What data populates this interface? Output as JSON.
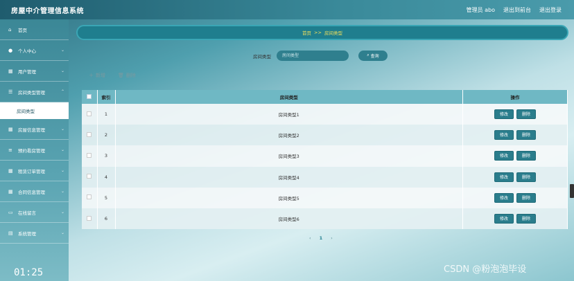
{
  "header": {
    "app_title": "房屋中介管理信息系统",
    "user_label": "管理员 abo",
    "console_label": "退出到前台",
    "logout_label": "退出登录"
  },
  "sidebar": {
    "items": [
      {
        "label": "首页",
        "icon": "home-icon"
      },
      {
        "label": "个人中心",
        "icon": "user-icon"
      },
      {
        "label": "用户管理",
        "icon": "grid-icon"
      },
      {
        "label": "房间类型管理",
        "icon": "list-icon"
      },
      {
        "label": "房屋信息管理",
        "icon": "grid-icon"
      },
      {
        "label": "预约看房管理",
        "icon": "sliders-icon"
      },
      {
        "label": "租赁订单管理",
        "icon": "grid-icon"
      },
      {
        "label": "合同信息管理",
        "icon": "grid-icon"
      },
      {
        "label": "在线留言",
        "icon": "monitor-icon"
      },
      {
        "label": "系统管理",
        "icon": "chart-icon"
      }
    ],
    "active_sub": "房间类型"
  },
  "breadcrumb": {
    "home": "首页",
    "separator": ">>",
    "current": "房间类型"
  },
  "search": {
    "label": "房间类型",
    "placeholder": "房间类型",
    "button_label": "查询"
  },
  "toolbar": {
    "add_label": "新增",
    "delete_label": "删除"
  },
  "table": {
    "headers": [
      "索引",
      "房间类型",
      "操作"
    ],
    "rows": [
      {
        "index": "1",
        "type": "房间类型1"
      },
      {
        "index": "2",
        "type": "房间类型2"
      },
      {
        "index": "3",
        "type": "房间类型3"
      },
      {
        "index": "4",
        "type": "房间类型4"
      },
      {
        "index": "5",
        "type": "房间类型5"
      },
      {
        "index": "6",
        "type": "房间类型6"
      }
    ],
    "edit_label": "修改",
    "delete_label": "删除"
  },
  "pagination": {
    "prev": "‹",
    "current": "1",
    "next": "›"
  },
  "overlay": {
    "clock": "01:25",
    "watermark": "CSDN @粉泡泡毕设"
  },
  "colors": {
    "accent": "#1f7e8e",
    "breadcrumb_text": "#f2e05a"
  }
}
